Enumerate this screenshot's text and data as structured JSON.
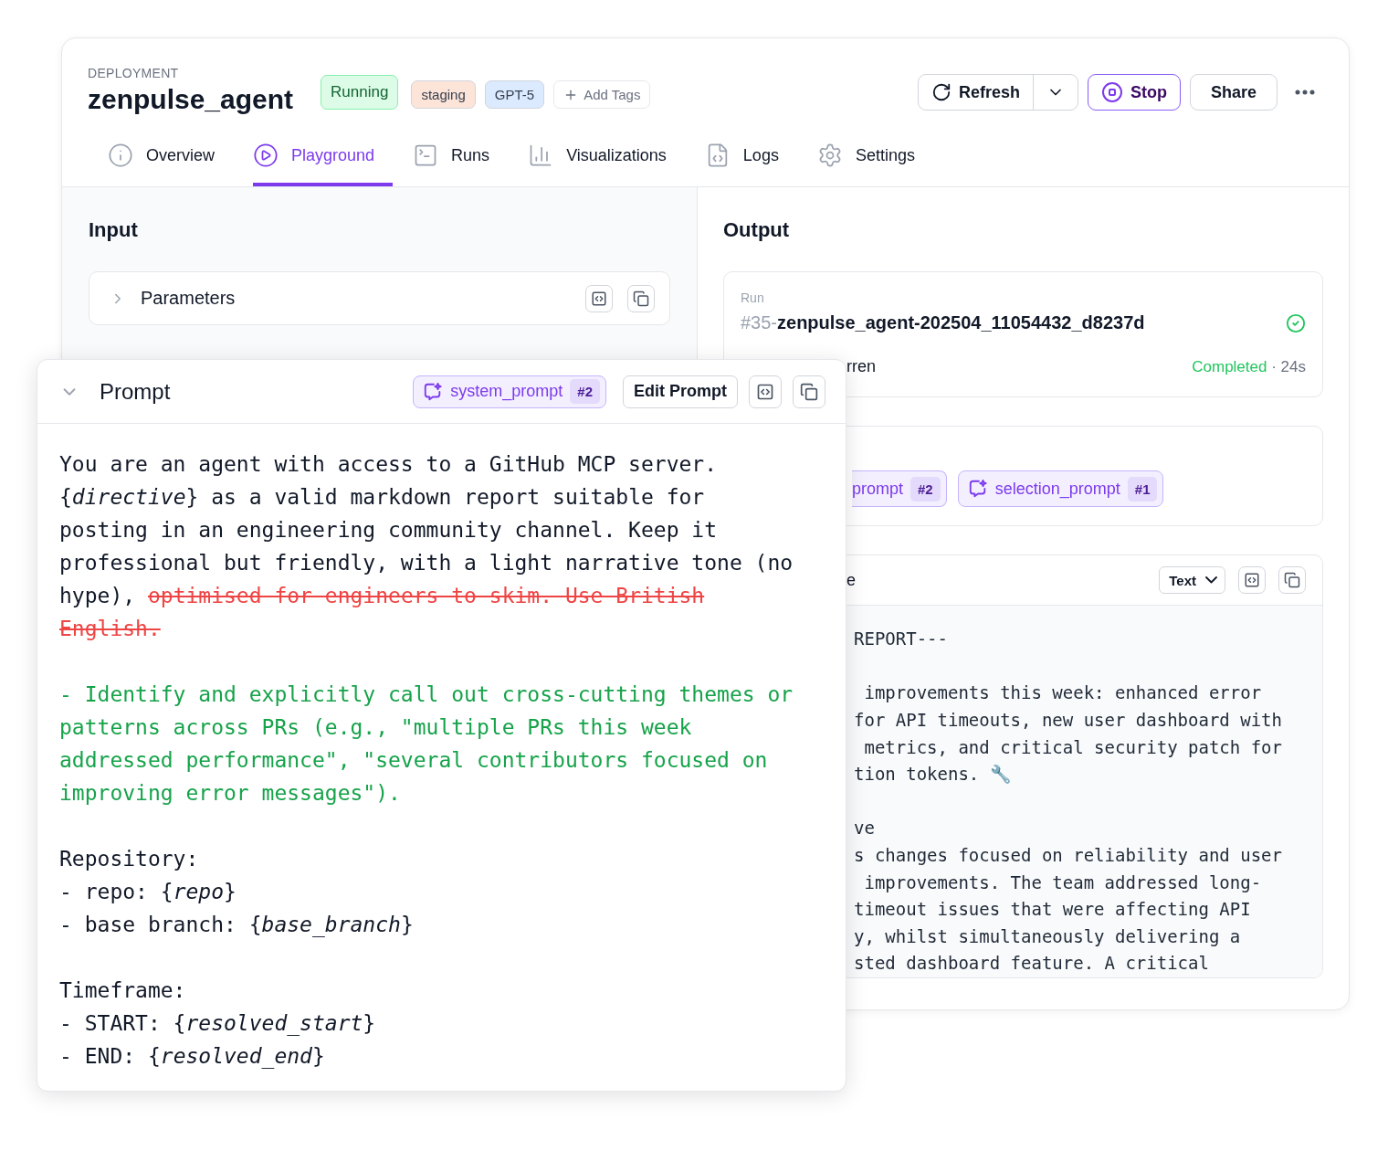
{
  "header": {
    "eyebrow": "DEPLOYMENT",
    "title": "zenpulse_agent",
    "status": "Running",
    "tags": [
      {
        "label": "staging",
        "color": "#fde4d8"
      },
      {
        "label": "GPT-5",
        "color": "#dbeafe"
      }
    ],
    "add_tags": "Add Tags",
    "refresh": "Refresh",
    "stop": "Stop",
    "share": "Share"
  },
  "tabs": [
    {
      "label": "Overview",
      "selected": false
    },
    {
      "label": "Playground",
      "selected": true
    },
    {
      "label": "Runs",
      "selected": false
    },
    {
      "label": "Visualizations",
      "selected": false
    },
    {
      "label": "Logs",
      "selected": false
    },
    {
      "label": "Settings",
      "selected": false
    }
  ],
  "input": {
    "title": "Input",
    "parameters": {
      "label": "Parameters",
      "expanded": false
    }
  },
  "prompt": {
    "title": "Prompt",
    "expanded": true,
    "template": "system_prompt",
    "version": "#2",
    "edit": "Edit Prompt",
    "paragraphs": [
      {
        "kind": "plain",
        "segments": [
          {
            "kind": "text",
            "text": "You are an agent with access to a GitHub MCP server.\n{*directive*} as a valid markdown report suitable for\nposting in an engineering community channel. Keep it\nprofessional but friendly, with a light narrative tone (no\nhype), "
          },
          {
            "kind": "deleted",
            "text": "optimised for engineers to skim. Use British\nEnglish."
          }
        ]
      },
      {
        "kind": "added",
        "segments": [
          {
            "kind": "text",
            "text": "- Identify and explicitly call out cross-cutting themes or\npatterns across PRs (e.g., \"multiple PRs this week\naddressed performance\", \"several contributors focused on\nimproving error messages\")."
          }
        ]
      },
      {
        "kind": "plain",
        "segments": [
          {
            "kind": "text",
            "text": "Repository:\n- repo: {*repo*}\n- base branch: {*base_branch*}"
          }
        ]
      },
      {
        "kind": "plain",
        "segments": [
          {
            "kind": "text",
            "text": "Timeframe:\n- START: {*resolved_start*}\n- END: {*resolved_end*}"
          }
        ]
      }
    ]
  },
  "output": {
    "title": "Output",
    "run": {
      "label": "Run",
      "number": "#35-",
      "name": "zenpulse_agent-202504_11054432_d8237d",
      "user": "rren",
      "status": "Completed",
      "duration": " · 24s"
    },
    "prompts": [
      {
        "name": "prompt",
        "version": "#2",
        "cut": true
      },
      {
        "name": "selection_prompt",
        "version": "#1",
        "cut": false
      }
    ],
    "response": {
      "title": "e",
      "format": "Text",
      "blocks": [
        [
          "REPORT---"
        ],
        [
          " improvements this week: enhanced error",
          "for API timeouts, new user dashboard with",
          " metrics, and critical security patch for",
          "tion tokens. 🔧"
        ],
        [
          "ve",
          "s changes focused on reliability and user",
          " improvements. The team addressed long-",
          "timeout issues that were affecting API",
          "y, whilst simultaneously delivering a",
          "sted dashboard feature. A critical"
        ]
      ]
    }
  }
}
